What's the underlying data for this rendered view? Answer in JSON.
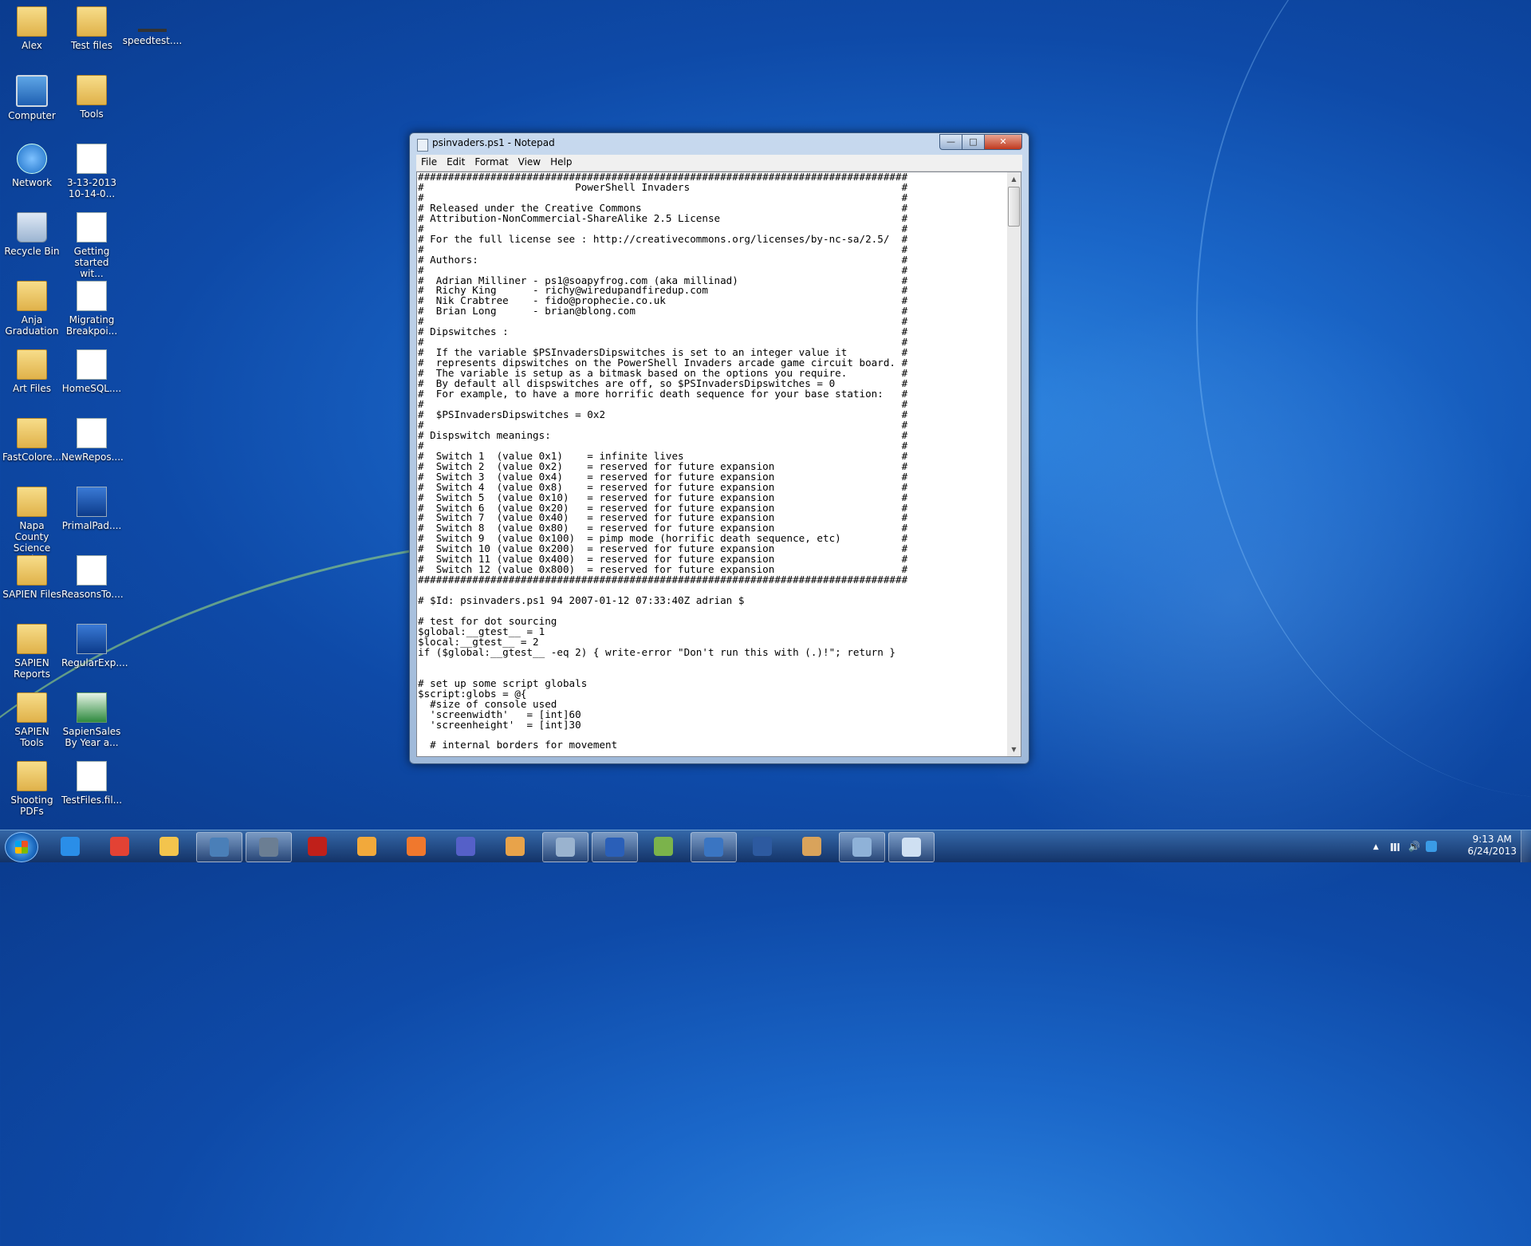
{
  "desktop": {
    "icons": [
      {
        "label": "Alex",
        "icon": "folder-icon"
      },
      {
        "label": "Test files",
        "icon": "folder-icon"
      },
      {
        "label": "speedtest....",
        "icon": "shortcut-icon"
      },
      {
        "label": "Computer",
        "icon": "computer-icon"
      },
      {
        "label": "Tools",
        "icon": "folder-icon"
      },
      {
        "label": "Network",
        "icon": "network-icon"
      },
      {
        "label": "3-13-2013 10-14-0...",
        "icon": "image-icon"
      },
      {
        "label": "Recycle Bin",
        "icon": "recycle-bin-icon"
      },
      {
        "label": "Getting started wit...",
        "icon": "document-icon"
      },
      {
        "label": "Anja Graduation",
        "icon": "folder-icon"
      },
      {
        "label": "Migrating Breakpoi...",
        "icon": "document-icon"
      },
      {
        "label": "Art Files",
        "icon": "folder-icon"
      },
      {
        "label": "HomeSQL....",
        "icon": "document-icon"
      },
      {
        "label": "FastColore...",
        "icon": "folder-icon"
      },
      {
        "label": "NewRepos....",
        "icon": "document-icon"
      },
      {
        "label": "Napa County Science Fai...",
        "icon": "folder-icon"
      },
      {
        "label": "PrimalPad....",
        "icon": "app-icon"
      },
      {
        "label": "SAPIEN Files",
        "icon": "folder-icon"
      },
      {
        "label": "ReasonsTo....",
        "icon": "document-icon"
      },
      {
        "label": "SAPIEN Reports",
        "icon": "folder-icon"
      },
      {
        "label": "RegularExp....",
        "icon": "app-icon"
      },
      {
        "label": "SAPIEN Tools",
        "icon": "folder-icon"
      },
      {
        "label": "SapienSales By Year a...",
        "icon": "excel-icon"
      },
      {
        "label": "Shooting PDFs",
        "icon": "folder-icon"
      },
      {
        "label": "TestFiles.fil...",
        "icon": "document-icon"
      }
    ]
  },
  "notepad": {
    "title": "psinvaders.ps1 - Notepad",
    "buttons": {
      "minimize": "—",
      "maximize": "□",
      "close": "✕"
    },
    "menu": [
      "File",
      "Edit",
      "Format",
      "View",
      "Help"
    ],
    "content": "#################################################################################\n#                         PowerShell Invaders                                   #\n#                                                                               #\n# Released under the Creative Commons                                           #\n# Attribution-NonCommercial-ShareAlike 2.5 License                              #\n#                                                                               #\n# For the full license see : http://creativecommons.org/licenses/by-nc-sa/2.5/  #\n#                                                                               #\n# Authors:                                                                      #\n#                                                                               #\n#  Adrian Milliner - ps1@soapyfrog.com (aka millinad)                           #\n#  Richy King      - richy@wiredupandfiredup.com                                #\n#  Nik Crabtree    - fido@prophecie.co.uk                                       #\n#  Brian Long      - brian@blong.com                                            #\n#                                                                               #\n# Dipswitches :                                                                 #\n#                                                                               #\n#  If the variable $PSInvadersDipswitches is set to an integer value it         #\n#  represents dipswitches on the PowerShell Invaders arcade game circuit board. #\n#  The variable is setup as a bitmask based on the options you require.         #\n#  By default all dispswitches are off, so $PSInvadersDipswitches = 0           #\n#  For example, to have a more horrific death sequence for your base station:   #\n#                                                                               #\n#  $PSInvadersDipswitches = 0x2                                                 #\n#                                                                               #\n# Dispswitch meanings:                                                          #\n#                                                                               #\n#  Switch 1  (value 0x1)    = infinite lives                                    #\n#  Switch 2  (value 0x2)    = reserved for future expansion                     #\n#  Switch 3  (value 0x4)    = reserved for future expansion                     #\n#  Switch 4  (value 0x8)    = reserved for future expansion                     #\n#  Switch 5  (value 0x10)   = reserved for future expansion                     #\n#  Switch 6  (value 0x20)   = reserved for future expansion                     #\n#  Switch 7  (value 0x40)   = reserved for future expansion                     #\n#  Switch 8  (value 0x80)   = reserved for future expansion                     #\n#  Switch 9  (value 0x100)  = pimp mode (horrific death sequence, etc)          #\n#  Switch 10 (value 0x200)  = reserved for future expansion                     #\n#  Switch 11 (value 0x400)  = reserved for future expansion                     #\n#  Switch 12 (value 0x800)  = reserved for future expansion                     #\n#################################################################################\n\n# $Id: psinvaders.ps1 94 2007-01-12 07:33:40Z adrian $\n\n# test for dot sourcing\n$global:__gtest__ = 1\n$local:__gtest__ = 2\nif ($global:__gtest__ -eq 2) { write-error \"Don't run this with (.)!\"; return }\n\n\n# set up some script globals\n$script:globs = @{\n  #size of console used\n  'screenwidth'   = [int]60\n  'screenheight'  = [int]30\n\n  # internal borders for movement"
  },
  "taskbar": {
    "apps": [
      {
        "name": "internet-explorer-icon",
        "color": "#2a8ee8"
      },
      {
        "name": "chrome-icon",
        "color": "#e34234"
      },
      {
        "name": "explorer-icon",
        "color": "#f3c44d"
      },
      {
        "name": "thunderbird-icon",
        "color": "#4a7fb8",
        "active": true
      },
      {
        "name": "book-icon",
        "color": "#6b7e93",
        "active": true
      },
      {
        "name": "filezilla-icon",
        "color": "#c0201a"
      },
      {
        "name": "folder-app-icon",
        "color": "#f2a93b"
      },
      {
        "name": "firefox-icon",
        "color": "#f0782d"
      },
      {
        "name": "infinity-icon",
        "color": "#5560c8"
      },
      {
        "name": "paint-icon",
        "color": "#e8a34a"
      },
      {
        "name": "pen-icon",
        "color": "#9ab3cf",
        "active": true
      },
      {
        "name": "b-app-icon",
        "color": "#2a5fb8",
        "active": true
      },
      {
        "name": "chart-icon",
        "color": "#7bb34b"
      },
      {
        "name": "vmware-icon",
        "color": "#3a75c2",
        "active": true
      },
      {
        "name": "powershell-icon",
        "color": "#2d5aa0"
      },
      {
        "name": "paint-brush-icon",
        "color": "#d9a35b"
      },
      {
        "name": "network-tool-icon",
        "color": "#8fb2d8",
        "active": true
      },
      {
        "name": "notepad-icon",
        "color": "#cfe0f2",
        "active": true
      }
    ],
    "clock": {
      "time": "9:13 AM",
      "date": "6/24/2013"
    }
  }
}
